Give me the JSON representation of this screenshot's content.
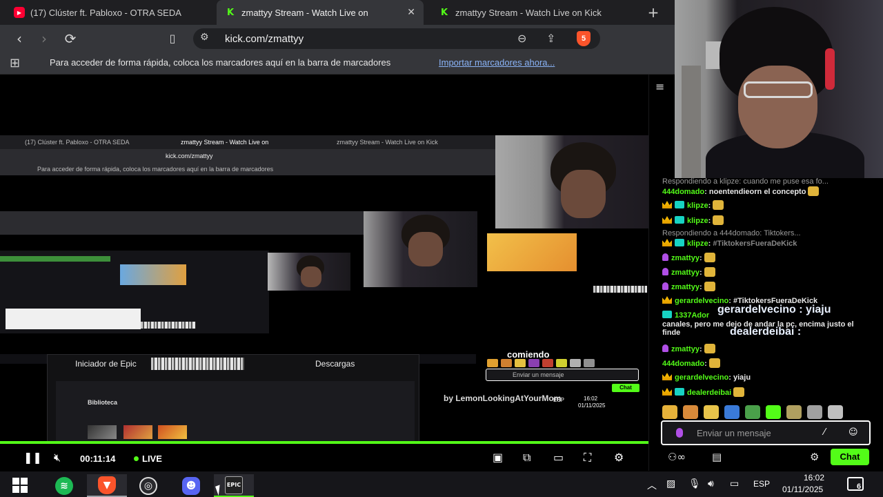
{
  "browser": {
    "tabs": [
      {
        "label": "(17) Clúster ft. Pabloxo - OTRA SEDA",
        "icon": "youtube-icon",
        "active": false
      },
      {
        "label": "zmattyy Stream - Watch Live on",
        "icon": "kick-icon",
        "active": true
      },
      {
        "label": "zmattyy Stream - Watch Live on Kick",
        "icon": "kick-icon",
        "active": false
      }
    ],
    "new_tab": "+",
    "url": "kick.com/zmattyy",
    "shield_count": "5",
    "bookmarks_hint": "Para acceder de forma rápida, coloca los marcadores aquí en la barra de marcadores",
    "bookmarks_link": "Importar marcadores ahora..."
  },
  "player": {
    "elapsed": "00:11:14",
    "live_label": "LIVE",
    "overlay": {
      "title_fragment": "comiendo",
      "caption": "by LemonLookingAtYourMom",
      "epic_launcher": "Iniciador de Epic",
      "downloads": "Descargas",
      "library": "Biblioteca",
      "chat_placeholder": "Enviar un mensaje",
      "chat_send": "Chat",
      "lang": "ESP",
      "time": "16:02",
      "date": "01/11/2025"
    }
  },
  "chat": {
    "lines": [
      {
        "type": "reply",
        "text": "Respondiendo a klipze: cuando me puse esa fo..."
      },
      {
        "user": "444domado",
        "text": "noentendieorn el concepto",
        "badges": []
      },
      {
        "user": "klipze",
        "text": "",
        "badges": [
          "crown",
          "sub"
        ]
      },
      {
        "user": "klipze",
        "text": "",
        "badges": [
          "crown",
          "sub"
        ]
      },
      {
        "type": "reply",
        "text": "Respondiendo a 444domado: Tiktokers..."
      },
      {
        "user": "klipze",
        "text": "#TiktokersFueraDeKick",
        "badges": [
          "crown",
          "sub"
        ]
      },
      {
        "user": "zmattyy",
        "text": "",
        "badges": [
          "mic"
        ]
      },
      {
        "user": "zmattyy",
        "text": "",
        "badges": [
          "mic"
        ]
      },
      {
        "user": "zmattyy",
        "text": "",
        "badges": [
          "mic"
        ]
      },
      {
        "user": "gerardelvecino",
        "text": "#TiktokersFueraDeKick",
        "badges": [
          "crown"
        ]
      },
      {
        "user": "1337Ador",
        "text": "canales, pero me dejo de andar la pc, encima justo el finde",
        "badges": [
          "sub"
        ]
      },
      {
        "user": "zmattyy",
        "text": "",
        "badges": [
          "mic"
        ]
      },
      {
        "user": "444domado",
        "text": "",
        "badges": []
      },
      {
        "user": "gerardelvecino",
        "text": "yiaju",
        "badges": [
          "crown"
        ]
      },
      {
        "user": "dealerdeibai",
        "text": "",
        "badges": [
          "crown",
          "sub"
        ]
      }
    ],
    "highlight_1": "gerardelvecino : yiaju",
    "highlight_2": "dealerdeibai :",
    "input_placeholder": "Enviar un mensaje",
    "send_label": "Chat"
  },
  "taskbar": {
    "apps": [
      "spotify",
      "brave",
      "obs",
      "discord",
      "epic-games"
    ],
    "epic_label": "EPIC",
    "lang": "ESP",
    "time": "16:02",
    "date": "01/11/2025",
    "notifications": "6"
  },
  "colors": {
    "kick_green": "#53fc18",
    "chrome_dark": "#35363a",
    "tab_bar": "#1f1f22"
  }
}
